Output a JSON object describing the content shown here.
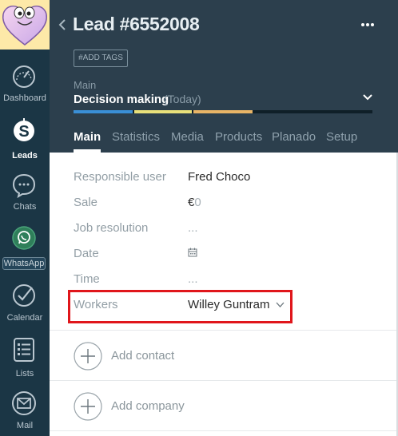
{
  "nav": {
    "items": [
      {
        "label": "Dashboard",
        "icon": "speedometer-icon"
      },
      {
        "label": "Leads",
        "icon": "leads-dollar-icon"
      },
      {
        "label": "Chats",
        "icon": "chat-bubble-icon"
      },
      {
        "label": "WhatsApp",
        "icon": "whatsapp-icon"
      },
      {
        "label": "Calendar",
        "icon": "calendar-check-icon"
      },
      {
        "label": "Lists",
        "icon": "list-icon"
      },
      {
        "label": "Mail",
        "icon": "mail-icon"
      }
    ],
    "active": "Leads"
  },
  "header": {
    "title": "Lead #6552008",
    "tags_button": "#ADD TAGS",
    "pipeline": "Main",
    "stage": "Decision making",
    "stage_date": "(Today)",
    "tabs": [
      {
        "label": "Main",
        "active": true
      },
      {
        "label": "Statistics",
        "active": false
      },
      {
        "label": "Media",
        "active": false
      },
      {
        "label": "Products",
        "active": false
      },
      {
        "label": "Planado",
        "active": false
      },
      {
        "label": "Setup",
        "active": false
      }
    ],
    "progress_colors": [
      "#3a8fd6",
      "#e8e07a",
      "#e8b466",
      "#0f1f28"
    ]
  },
  "fields": [
    {
      "label": "Responsible user",
      "value": "Fred Choco"
    },
    {
      "label": "Sale",
      "currency": "€",
      "value": "0"
    },
    {
      "label": "Job resolution",
      "value": "..."
    },
    {
      "label": "Date",
      "value": "",
      "icon": "calendar-icon"
    },
    {
      "label": "Time",
      "value": "..."
    },
    {
      "label": "Workers",
      "value": "Willey Guntram"
    }
  ],
  "actions": {
    "add_contact": "Add contact",
    "add_company": "Add company"
  },
  "colors": {
    "nav_bg": "#1b3645",
    "header_bg": "#2c3f4d",
    "highlight": "#e0161b"
  }
}
